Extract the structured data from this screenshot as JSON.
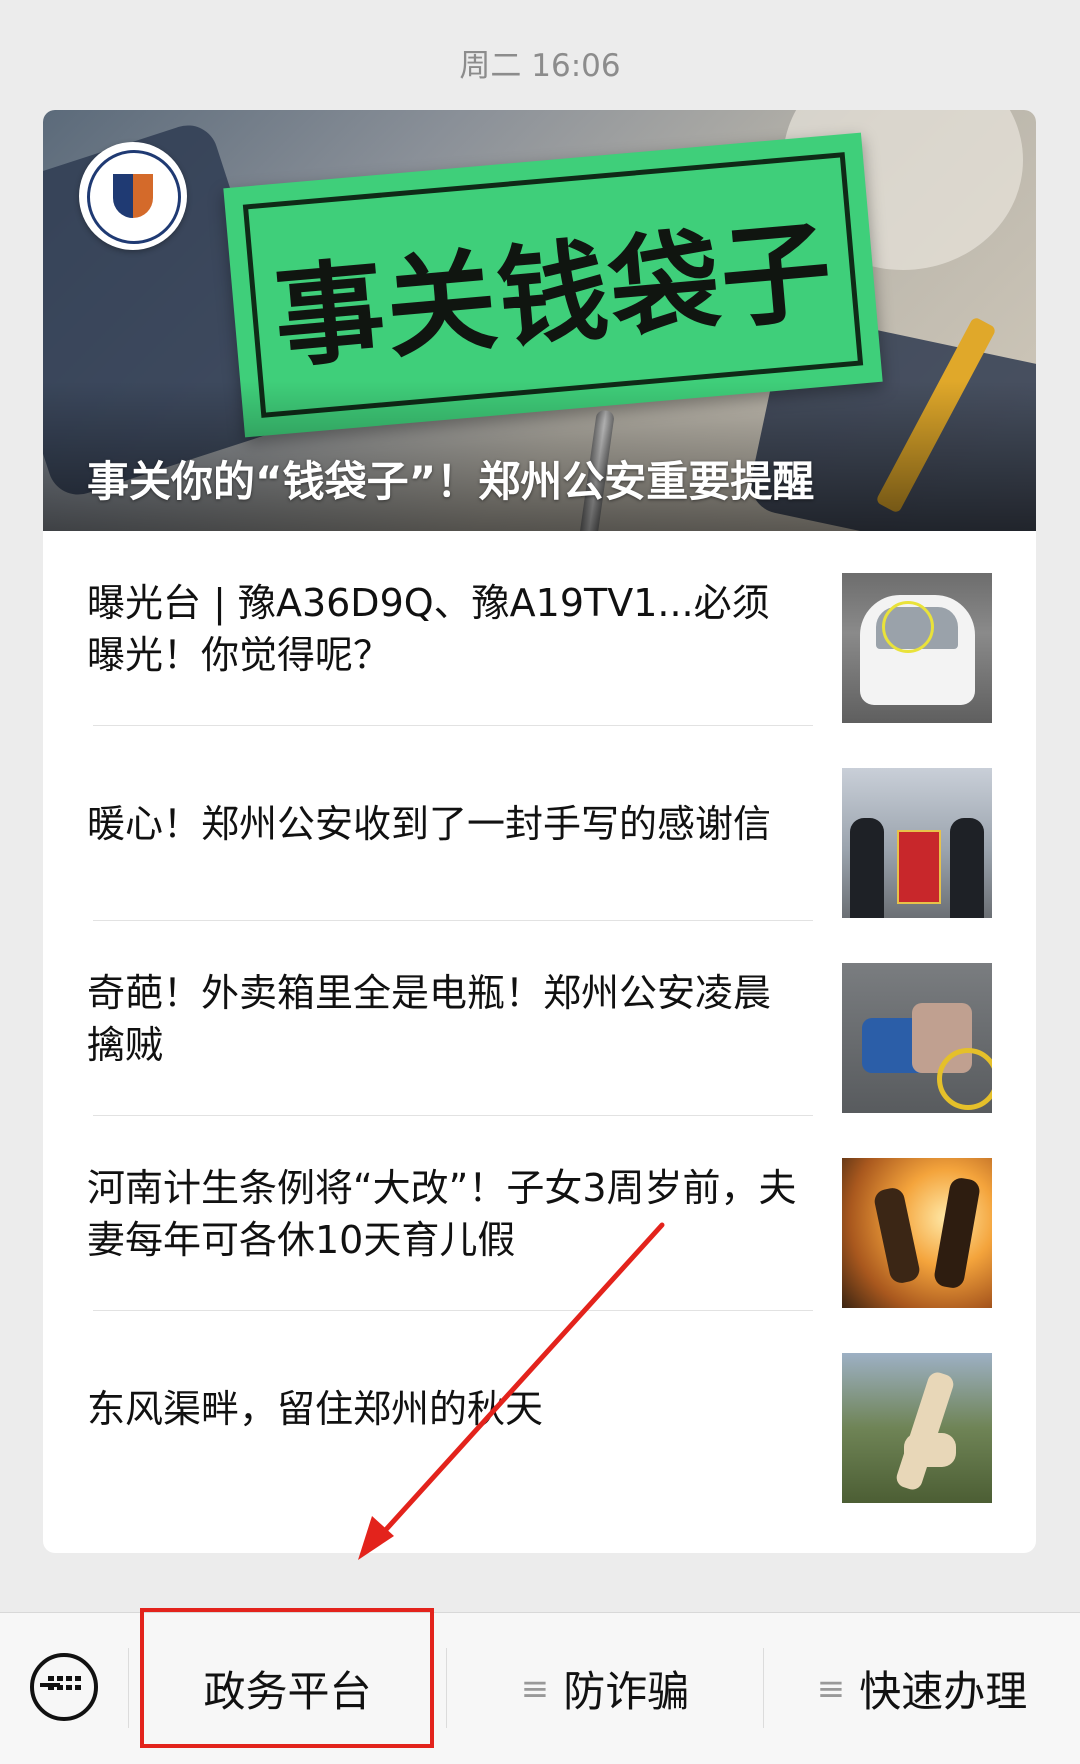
{
  "timestamp": "周二 16:06",
  "hero": {
    "sign_text": "事关钱袋子",
    "title": "事关你的“钱袋子”！郑州公安重要提醒",
    "logo": "police-badge-logo"
  },
  "articles": [
    {
      "title": "曝光台 | 豫A36D9Q、豫A19TV1...必须曝光！你觉得呢？",
      "thumb": "car-surveillance-photo"
    },
    {
      "title": "暖心！郑州公安收到了一封手写的感谢信",
      "thumb": "police-receiving-banner-photo"
    },
    {
      "title": "奇葩！外卖箱里全是电瓶！郑州公安凌晨擒贼",
      "thumb": "street-surveillance-photo"
    },
    {
      "title": "河南计生条例将“大改”！子女3周岁前，夫妻每年可各休10天育儿假",
      "thumb": "family-sunset-photo"
    },
    {
      "title": "东风渠畔，留住郑州的秋天",
      "thumb": "giraffe-sculpture-photo"
    }
  ],
  "bottom_menu": {
    "keyboard_icon": "keyboard-icon",
    "items": [
      {
        "label": "政务平台"
      },
      {
        "label": "防诈骗",
        "icon": "≡"
      },
      {
        "label": "快速办理",
        "icon": "≡"
      }
    ]
  },
  "annotation": {
    "color": "#e3231c"
  }
}
